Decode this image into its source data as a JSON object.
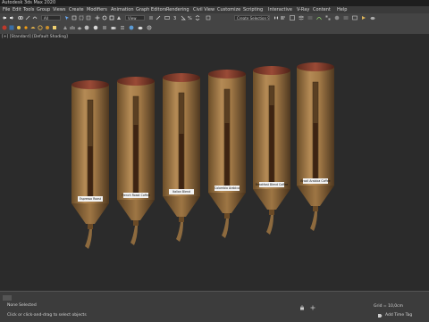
{
  "app_title": "Autodesk 3ds Max 2020",
  "menu": [
    "File",
    "Edit",
    "Tools",
    "Group",
    "Views",
    "Create",
    "Modifiers",
    "Animation",
    "Graph Editors",
    "Rendering",
    "Civil View",
    "Customize",
    "Scripting",
    "Interactive",
    "V-Ray",
    "Content",
    "Help"
  ],
  "toolbar": {
    "selection_filter": "All",
    "reference_coord": "View",
    "named_selection": "Create Selection Se"
  },
  "viewport_label": "[+] [Standard] [Default Shading]",
  "dispensers": [
    {
      "label": "Espresso Roast"
    },
    {
      "label": "French Roast Coffee"
    },
    {
      "label": "Italian Blend"
    },
    {
      "label": "Colombia Arabica"
    },
    {
      "label": "Breakfast Blend Coffee"
    },
    {
      "label": "Brazil Arabica Coffee"
    }
  ],
  "status": {
    "selection": "None Selected",
    "prompt": "Click or click-and-drag to select objects",
    "grid": "Grid = 10,0cm",
    "add_time_tag": "Add Time Tag"
  },
  "colors": {
    "tube": "#a07a48",
    "tube_shadow": "#5e4324",
    "cap": "#8a3f2e",
    "beans": "#4a2a16",
    "viewport_bg": "#2b2b2b"
  }
}
